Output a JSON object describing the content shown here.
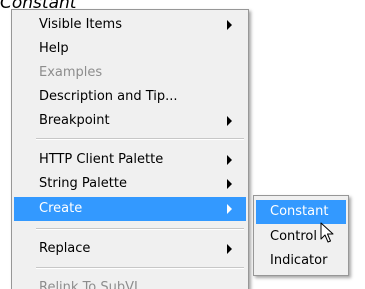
{
  "heading": "Constant",
  "context_menu": {
    "items": [
      {
        "label": "Visible Items",
        "submenu": true
      },
      {
        "label": "Help"
      },
      {
        "label": "Examples",
        "disabled": true
      },
      {
        "label": "Description and Tip..."
      },
      {
        "label": "Breakpoint",
        "submenu": true
      },
      {
        "label": "HTTP Client Palette",
        "submenu": true
      },
      {
        "label": "String Palette",
        "submenu": true
      },
      {
        "label": "Create",
        "submenu": true,
        "highlighted": true
      },
      {
        "label": "Replace",
        "submenu": true
      },
      {
        "label": "Relink To SubVI",
        "disabled": true
      }
    ]
  },
  "create_submenu": {
    "items": [
      {
        "label": "Constant",
        "highlighted": true
      },
      {
        "label": "Control"
      },
      {
        "label": "Indicator"
      }
    ]
  },
  "colors": {
    "highlight": "#3399ff",
    "menu_bg": "#f0f0f0",
    "disabled_text": "#8d8d8d"
  },
  "cursor": "arrow-pointer-icon"
}
